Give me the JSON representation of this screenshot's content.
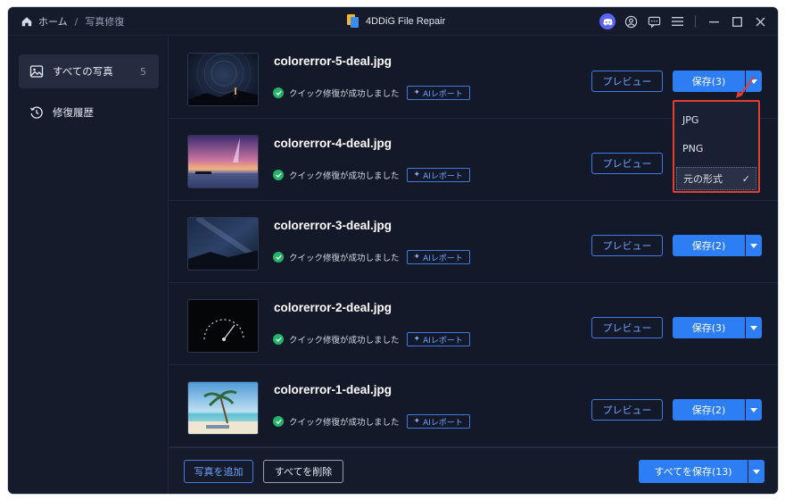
{
  "titlebar": {
    "home_label": "ホーム",
    "separator": "/",
    "current": "写真修復",
    "app_title": "4DDiG File Repair"
  },
  "sidebar": {
    "items": [
      {
        "label": "すべての写真",
        "count": "5",
        "icon": "image-icon"
      },
      {
        "label": "修復履歴",
        "icon": "history-icon"
      }
    ]
  },
  "rows": [
    {
      "filename": "colorerror-5-deal.jpg",
      "status": "クイック修復が成功しました",
      "ai_label": "AIレポート",
      "preview_label": "プレビュー",
      "save_label": "保存(3)"
    },
    {
      "filename": "colorerror-4-deal.jpg",
      "status": "クイック修復が成功しました",
      "ai_label": "AIレポート",
      "preview_label": "プレビュー",
      "save_label": ""
    },
    {
      "filename": "colorerror-3-deal.jpg",
      "status": "クイック修復が成功しました",
      "ai_label": "AIレポート",
      "preview_label": "プレビュー",
      "save_label": "保存(2)"
    },
    {
      "filename": "colorerror-2-deal.jpg",
      "status": "クイック修復が成功しました",
      "ai_label": "AIレポート",
      "preview_label": "プレビュー",
      "save_label": "保存(3)"
    },
    {
      "filename": "colorerror-1-deal.jpg",
      "status": "クイック修復が成功しました",
      "ai_label": "AIレポート",
      "preview_label": "プレビュー",
      "save_label": "保存(2)"
    }
  ],
  "dropdown": {
    "options": [
      "JPG",
      "PNG",
      "元の形式"
    ],
    "selected": "元の形式"
  },
  "bottom": {
    "add_label": "写真を追加",
    "delete_label": "すべてを削除",
    "save_all_label": "すべてを保存(13)"
  },
  "colors": {
    "accent": "#2d7df4",
    "highlight": "#e2402f",
    "success": "#21b46a",
    "background": "#14192a"
  }
}
